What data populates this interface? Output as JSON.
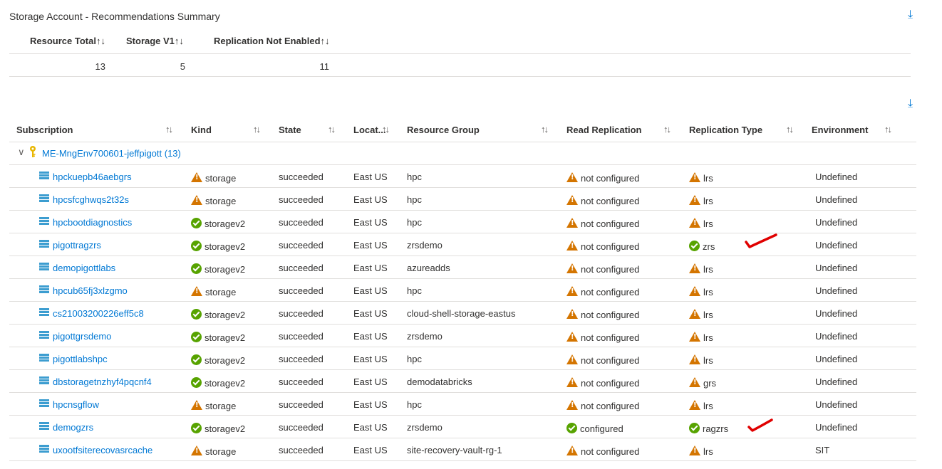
{
  "title": "Storage Account - Recommendations Summary",
  "summary": {
    "headers": [
      "Resource Total",
      "Storage V1",
      "Replication Not Enabled"
    ],
    "values": [
      "13",
      "5",
      "11"
    ]
  },
  "table": {
    "headers": [
      "Subscription",
      "Kind",
      "State",
      "Locat...",
      "Resource Group",
      "Read Replication",
      "Replication Type",
      "Environment"
    ],
    "group": "ME-MngEnv700601-jeffpigott (13)",
    "rows": [
      {
        "name": "hpckuepb46aebgrs",
        "kind": "storage",
        "kind_ok": false,
        "state": "succeeded",
        "loc": "East US",
        "rg": "hpc",
        "read": "not configured",
        "read_ok": false,
        "type": "lrs",
        "type_ok": false,
        "env": "Undefined"
      },
      {
        "name": "hpcsfcghwqs2t32s",
        "kind": "storage",
        "kind_ok": false,
        "state": "succeeded",
        "loc": "East US",
        "rg": "hpc",
        "read": "not configured",
        "read_ok": false,
        "type": "lrs",
        "type_ok": false,
        "env": "Undefined"
      },
      {
        "name": "hpcbootdiagnostics",
        "kind": "storagev2",
        "kind_ok": true,
        "state": "succeeded",
        "loc": "East US",
        "rg": "hpc",
        "read": "not configured",
        "read_ok": false,
        "type": "lrs",
        "type_ok": false,
        "env": "Undefined"
      },
      {
        "name": "pigottragzrs",
        "kind": "storagev2",
        "kind_ok": true,
        "state": "succeeded",
        "loc": "East US",
        "rg": "zrsdemo",
        "read": "not configured",
        "read_ok": false,
        "type": "zrs",
        "type_ok": true,
        "env": "Undefined",
        "check": true
      },
      {
        "name": "demopigottlabs",
        "kind": "storagev2",
        "kind_ok": true,
        "state": "succeeded",
        "loc": "East US",
        "rg": "azureadds",
        "read": "not configured",
        "read_ok": false,
        "type": "lrs",
        "type_ok": false,
        "env": "Undefined"
      },
      {
        "name": "hpcub65fj3xlzgmo",
        "kind": "storage",
        "kind_ok": false,
        "state": "succeeded",
        "loc": "East US",
        "rg": "hpc",
        "read": "not configured",
        "read_ok": false,
        "type": "lrs",
        "type_ok": false,
        "env": "Undefined"
      },
      {
        "name": "cs21003200226eff5c8",
        "kind": "storagev2",
        "kind_ok": true,
        "state": "succeeded",
        "loc": "East US",
        "rg": "cloud-shell-storage-eastus",
        "read": "not configured",
        "read_ok": false,
        "type": "lrs",
        "type_ok": false,
        "env": "Undefined"
      },
      {
        "name": "pigottgrsdemo",
        "kind": "storagev2",
        "kind_ok": true,
        "state": "succeeded",
        "loc": "East US",
        "rg": "zrsdemo",
        "read": "not configured",
        "read_ok": false,
        "type": "lrs",
        "type_ok": false,
        "env": "Undefined"
      },
      {
        "name": "pigottlabshpc",
        "kind": "storagev2",
        "kind_ok": true,
        "state": "succeeded",
        "loc": "East US",
        "rg": "hpc",
        "read": "not configured",
        "read_ok": false,
        "type": "lrs",
        "type_ok": false,
        "env": "Undefined"
      },
      {
        "name": "dbstoragetnzhyf4pqcnf4",
        "kind": "storagev2",
        "kind_ok": true,
        "state": "succeeded",
        "loc": "East US",
        "rg": "demodatabricks",
        "read": "not configured",
        "read_ok": false,
        "type": "grs",
        "type_ok": false,
        "env": "Undefined"
      },
      {
        "name": "hpcnsgflow",
        "kind": "storage",
        "kind_ok": false,
        "state": "succeeded",
        "loc": "East US",
        "rg": "hpc",
        "read": "not configured",
        "read_ok": false,
        "type": "lrs",
        "type_ok": false,
        "env": "Undefined"
      },
      {
        "name": "demogzrs",
        "kind": "storagev2",
        "kind_ok": true,
        "state": "succeeded",
        "loc": "East US",
        "rg": "zrsdemo",
        "read": "configured",
        "read_ok": true,
        "type": "ragzrs",
        "type_ok": true,
        "env": "Undefined",
        "check": true
      },
      {
        "name": "uxootfsiterecovasrcache",
        "kind": "storage",
        "kind_ok": false,
        "state": "succeeded",
        "loc": "East US",
        "rg": "site-recovery-vault-rg-1",
        "read": "not configured",
        "read_ok": false,
        "type": "lrs",
        "type_ok": false,
        "env": "SIT"
      }
    ]
  },
  "colors": {
    "link": "#0078d4",
    "warning": "#d47500",
    "ok": "#57a300",
    "annotation": "#e00000"
  }
}
